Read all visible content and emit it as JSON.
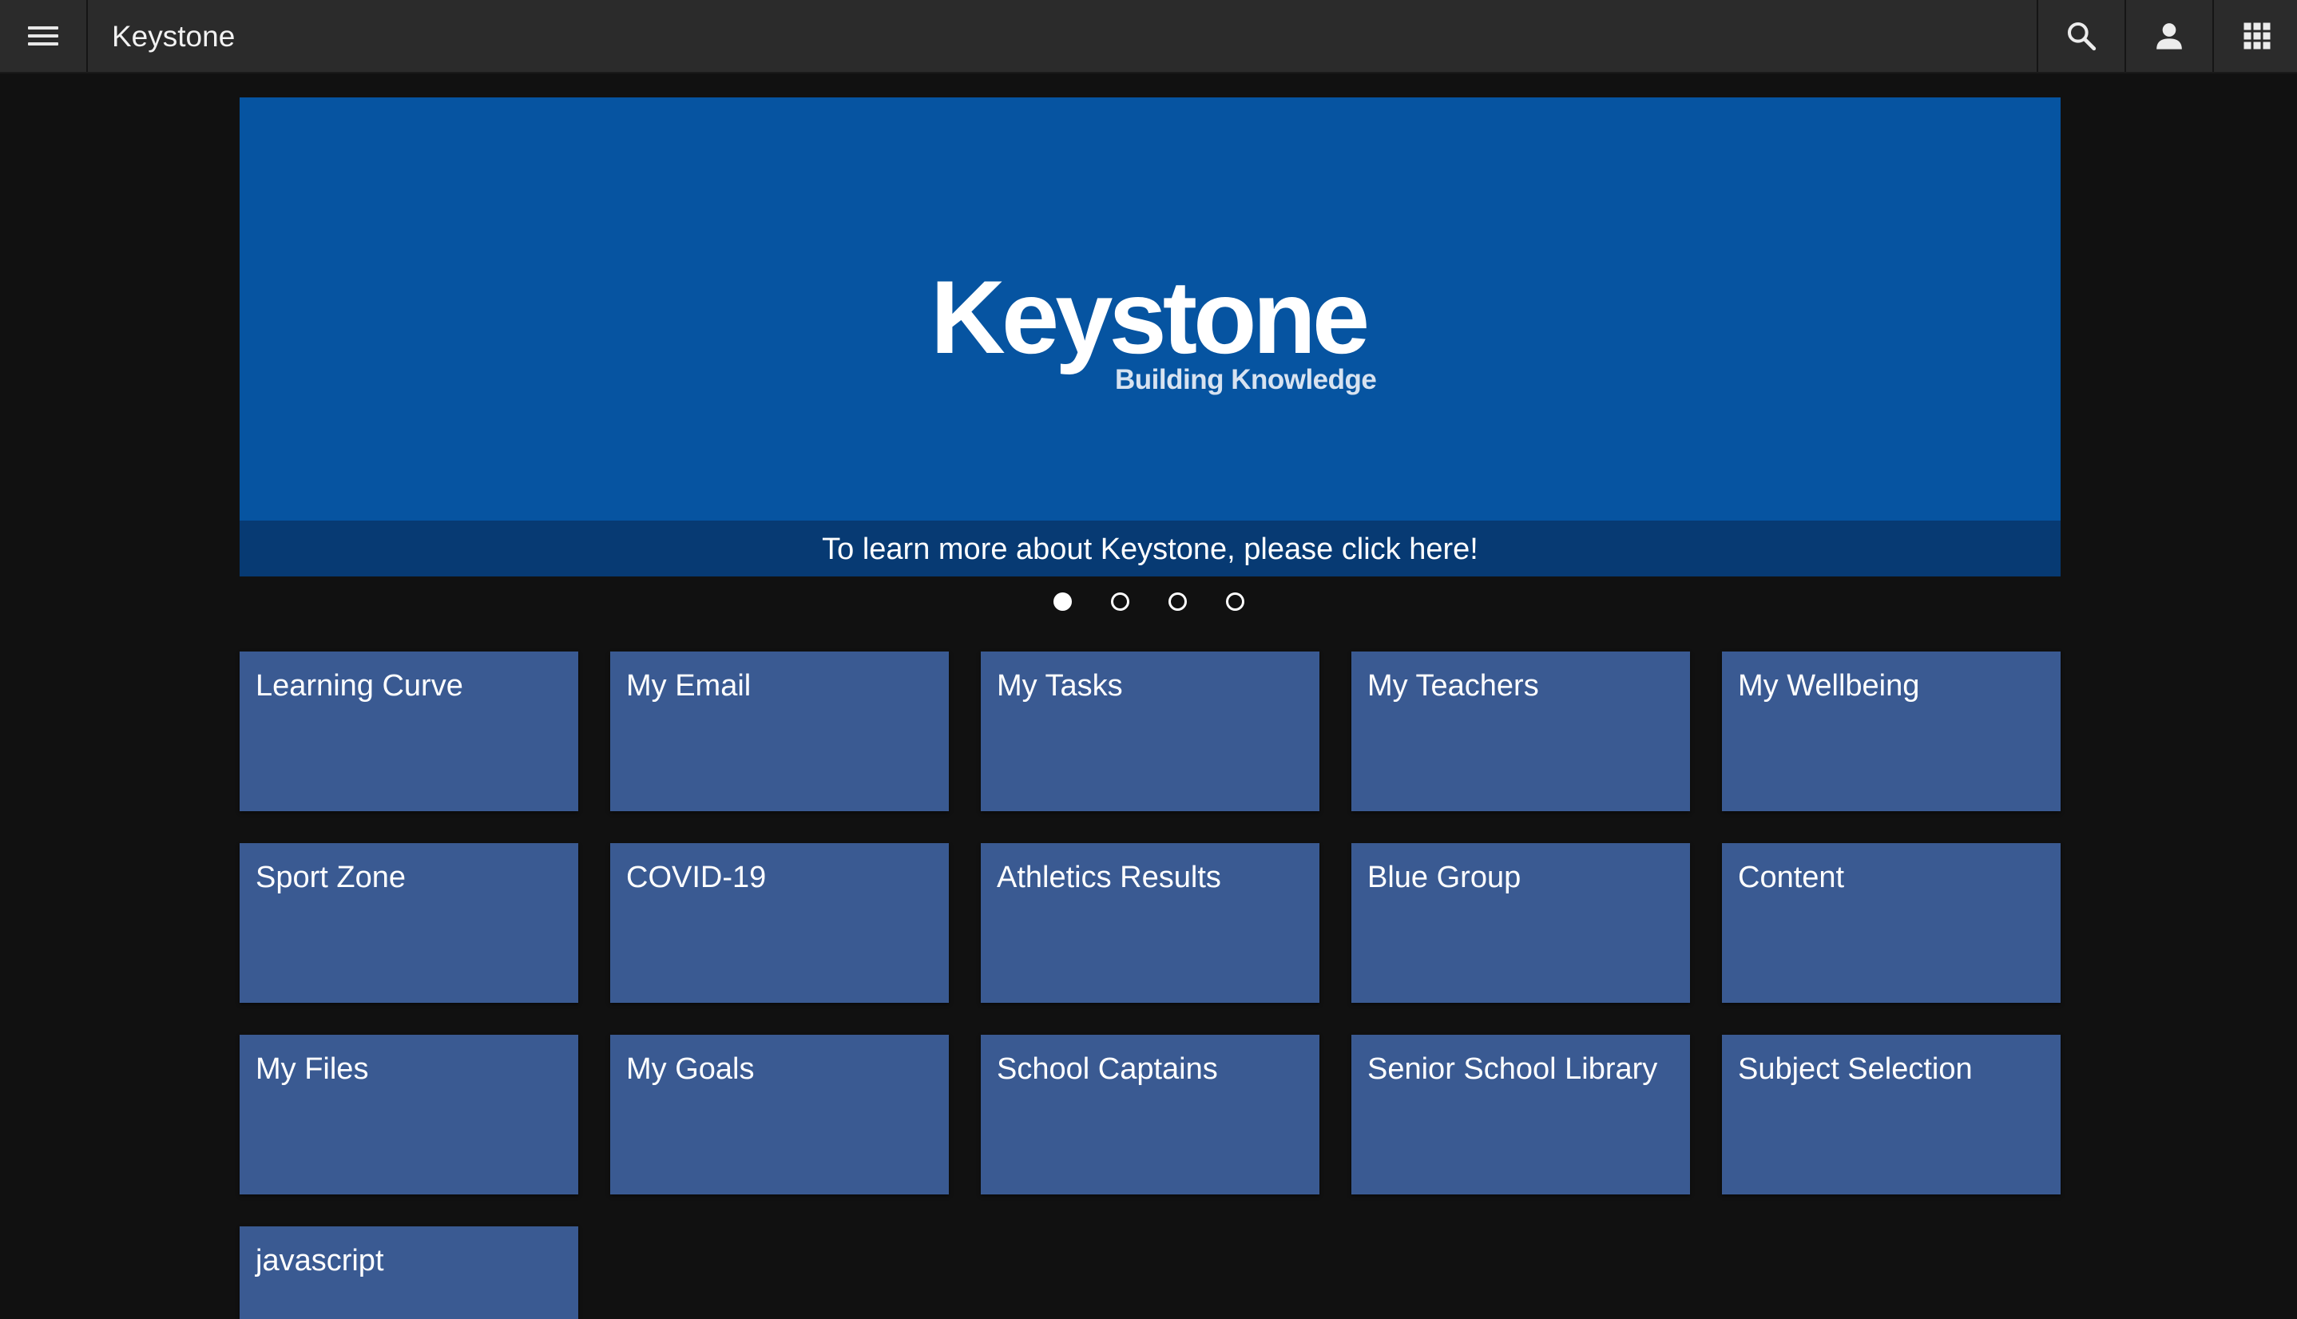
{
  "header": {
    "title": "Keystone",
    "icons": {
      "menu": "menu-icon",
      "search": "search-icon",
      "account": "account-icon",
      "apps": "apps-grid-icon"
    }
  },
  "banner": {
    "logo_text": "Keystone",
    "logo_tagline": "Building Knowledge",
    "caption": "To learn more about Keystone, please click here!",
    "background_color": "#0654a1",
    "caption_color": "#073a73"
  },
  "carousel": {
    "slide_count": 4,
    "active_index": 0
  },
  "tiles": [
    {
      "label": "Learning Curve"
    },
    {
      "label": "My Email"
    },
    {
      "label": "My Tasks"
    },
    {
      "label": "My Teachers"
    },
    {
      "label": "My Wellbeing"
    },
    {
      "label": "Sport Zone"
    },
    {
      "label": "COVID-19"
    },
    {
      "label": "Athletics Results"
    },
    {
      "label": "Blue Group"
    },
    {
      "label": "Content"
    },
    {
      "label": "My Files"
    },
    {
      "label": "My Goals"
    },
    {
      "label": "School Captains"
    },
    {
      "label": "Senior School Library"
    },
    {
      "label": "Subject Selection"
    },
    {
      "label": "javascript"
    }
  ],
  "colors": {
    "page_background": "#111111",
    "topbar_background": "#2b2b2b",
    "tile_background": "#3a5a92"
  }
}
